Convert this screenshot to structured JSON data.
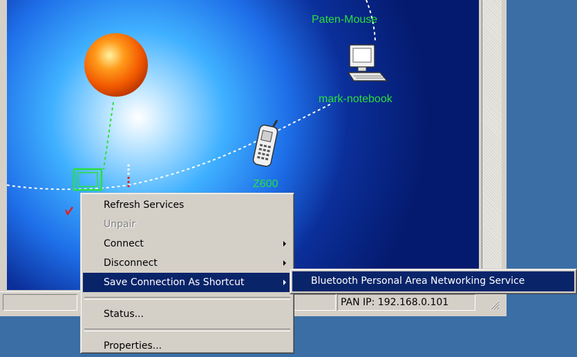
{
  "devices": [
    {
      "name": "Paten-Mouse",
      "icon": "mouse-icon"
    },
    {
      "name": "mark-notebook",
      "icon": "computer-icon"
    },
    {
      "name": "Z600",
      "icon": "mobile-phone-icon"
    }
  ],
  "status_bar": {
    "panel1": "",
    "panel2": "",
    "pan_ip": "PAN IP: 192.168.0.101"
  },
  "context_menu": {
    "items": [
      {
        "label": "Refresh Services",
        "enabled": true
      },
      {
        "label": "Unpair",
        "enabled": false
      },
      {
        "label": "Connect",
        "submenu": true
      },
      {
        "label": "Disconnect",
        "submenu": true
      },
      {
        "label": "Save Connection As Shortcut",
        "submenu": true,
        "selected": true
      },
      {
        "label": "Status..."
      },
      {
        "label": "Properties..."
      }
    ]
  },
  "submenu": {
    "items": [
      {
        "label": "Bluetooth Personal Area Networking Service",
        "selected": true
      }
    ]
  },
  "colors": {
    "selection": "#0a246a",
    "device_label": "#29e03a",
    "menu_bg": "#d4d0c8",
    "desktop": "#3a6ea5"
  }
}
